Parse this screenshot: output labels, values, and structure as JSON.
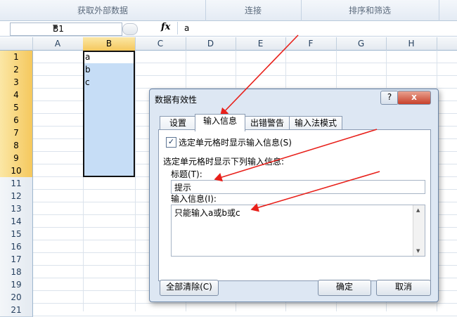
{
  "ribbon": {
    "groups": [
      "获取外部数据",
      "连接",
      "排序和筛选"
    ]
  },
  "formula_bar": {
    "name_box": "B1",
    "fx_label": "fx",
    "value": "a"
  },
  "columns": [
    "A",
    "B",
    "C",
    "D",
    "E",
    "F",
    "G",
    "H"
  ],
  "rows": [
    "1",
    "2",
    "3",
    "4",
    "5",
    "6",
    "7",
    "8",
    "9",
    "10",
    "11",
    "12",
    "13",
    "14",
    "15",
    "16",
    "17",
    "18",
    "19",
    "20",
    "21"
  ],
  "cells": {
    "B1": "a",
    "B2": "b",
    "B3": "c"
  },
  "dialog": {
    "title": "数据有效性",
    "help_label": "?",
    "close_label": "x",
    "tabs": [
      "设置",
      "输入信息",
      "出错警告",
      "输入法模式"
    ],
    "active_tab": "输入信息",
    "show_input_checkbox_label": "选定单元格时显示输入信息(S)",
    "show_input_checked": true,
    "section_label": "选定单元格时显示下列输入信息:",
    "title_field_label": "标题(T):",
    "title_field_value": "提示",
    "message_field_label": "输入信息(I):",
    "message_field_value": "只能输入a或b或c",
    "clear_all_button": "全部清除(C)",
    "ok_button": "确定",
    "cancel_button": "取消"
  },
  "colors": {
    "selection_fill": "#c6ddf6",
    "header_highlight": "#f5c85d",
    "annotation_arrow": "#e8201a"
  }
}
